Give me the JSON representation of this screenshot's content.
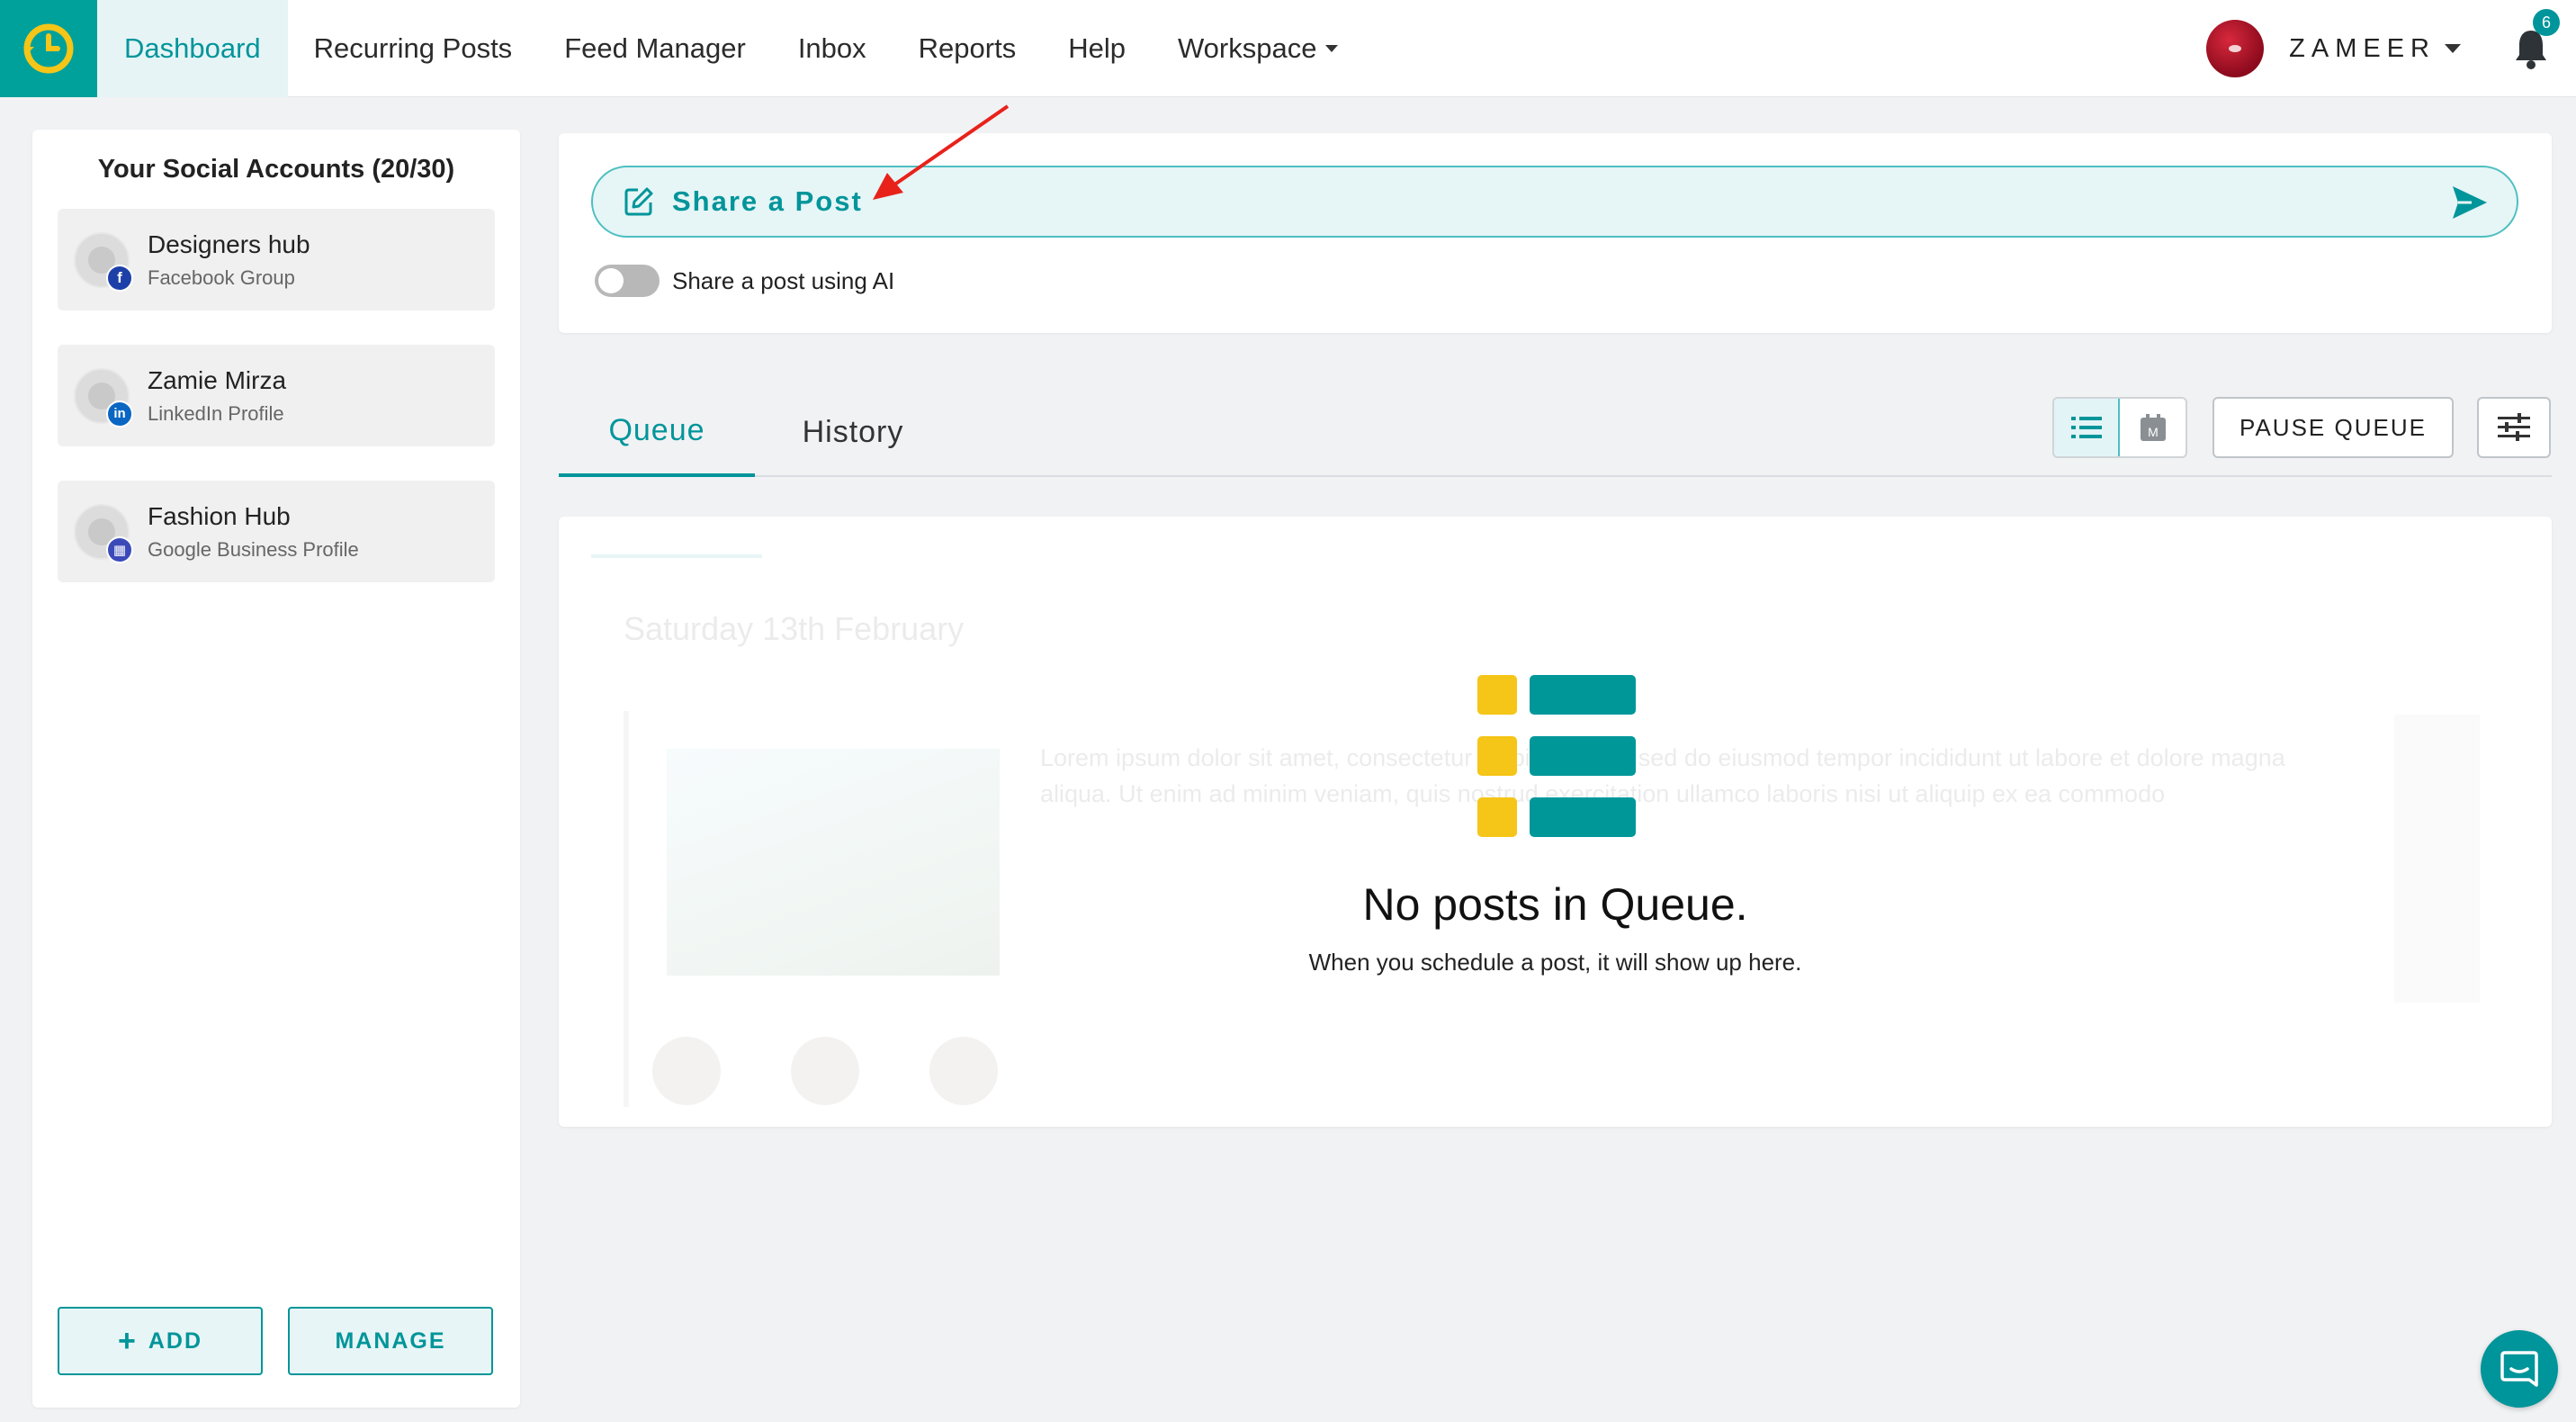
{
  "nav": {
    "items": [
      {
        "label": "Dashboard",
        "active": true
      },
      {
        "label": "Recurring Posts"
      },
      {
        "label": "Feed Manager"
      },
      {
        "label": "Inbox"
      },
      {
        "label": "Reports"
      },
      {
        "label": "Help"
      },
      {
        "label": "Workspace"
      }
    ],
    "user_name": "ZAMEER",
    "notification_count": "6"
  },
  "sidebar": {
    "title": "Your Social Accounts (20/30)",
    "accounts": [
      {
        "name": "Designers hub",
        "type": "Facebook Group",
        "network_icon": "facebook-icon",
        "badge_glyph": "f",
        "badge_color": "#1d3fa8"
      },
      {
        "name": "Zamie Mirza",
        "type": "LinkedIn Profile",
        "network_icon": "linkedin-icon",
        "badge_glyph": "in",
        "badge_color": "#0a66c2"
      },
      {
        "name": "Fashion Hub",
        "type": "Google Business Profile",
        "network_icon": "google-business-icon",
        "badge_glyph": "▦",
        "badge_color": "#3b4ab8"
      }
    ],
    "add_label": "ADD",
    "manage_label": "MANAGE"
  },
  "share": {
    "label": "Share a Post",
    "ai_toggle_label": "Share a post using AI",
    "ai_enabled": false
  },
  "tabs": {
    "queue": "Queue",
    "history": "History",
    "calendar_glyph": "M",
    "pause_label": "PAUSE QUEUE"
  },
  "queue": {
    "background_placeholder_date": "Saturday 13th February",
    "background_placeholder_text": "Lorem ipsum dolor sit amet, consectetur adipiscing elit, sed do eiusmod tempor incididunt ut labore et dolore magna aliqua. Ut enim ad minim veniam, quis nostrud exercitation ullamco laboris nisi ut aliquip ex ea commodo",
    "empty_title": "No posts in Queue.",
    "empty_subtitle": "When you schedule a post, it will show up here."
  },
  "colors": {
    "brand": "#00959a",
    "brand_light": "#e6f5f6",
    "logo_yellow": "#f5c518",
    "annotation": "#e8221b"
  }
}
